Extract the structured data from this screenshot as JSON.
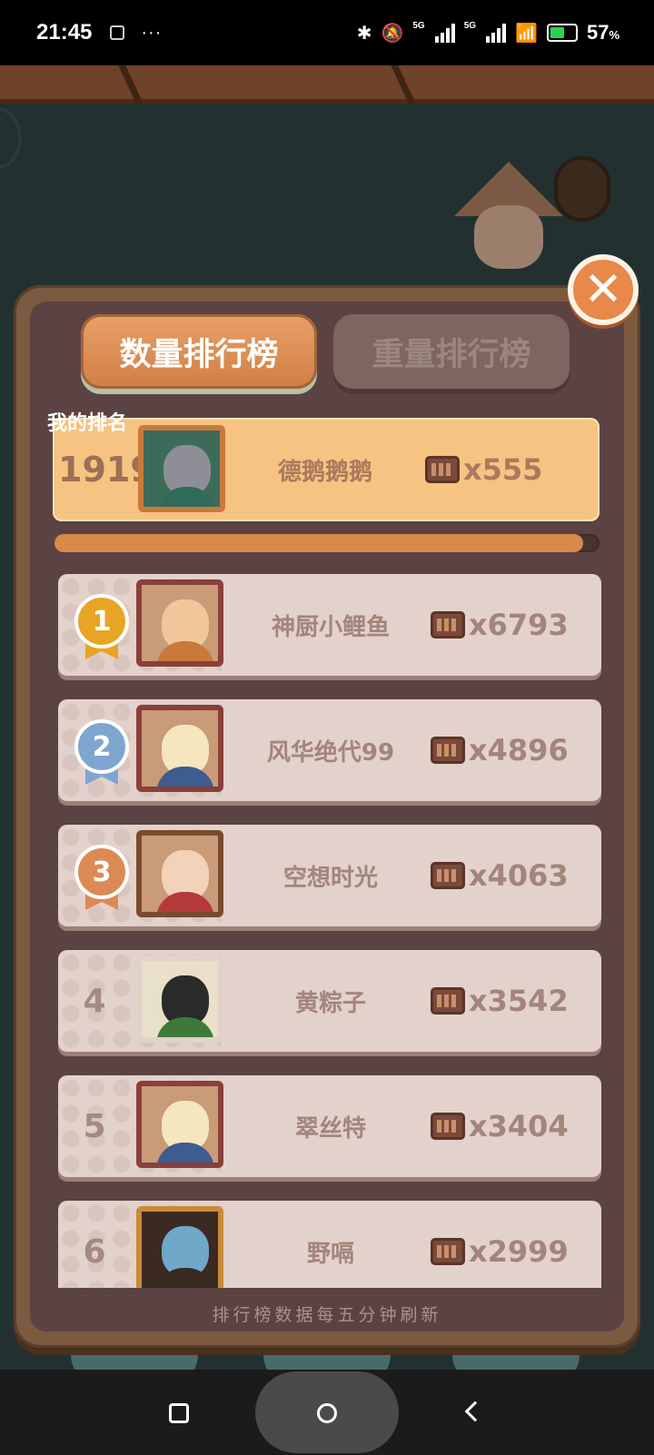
{
  "status_bar": {
    "time": "21:45",
    "dots": "···",
    "network_label": "5G",
    "battery_percent": 57,
    "battery_label": "57",
    "battery_unit": "%"
  },
  "tabs": {
    "count_ranking": "数量排行榜",
    "weight_ranking": "重量排行榜",
    "active": "count_ranking"
  },
  "my_rank": {
    "label": "我的排名",
    "rank": "1919",
    "name": "德鹅鹅鹅",
    "score": "x555"
  },
  "progress_fill": 0.97,
  "leaderboard": [
    {
      "rank": "1",
      "medal": "gold",
      "name": "神厨小鲤鱼",
      "score": "x6793"
    },
    {
      "rank": "2",
      "medal": "silver",
      "name": "风华绝代99",
      "score": "x4896"
    },
    {
      "rank": "3",
      "medal": "bronze",
      "name": "空想时光",
      "score": "x4063"
    },
    {
      "rank": "4",
      "name": "黄粽子",
      "score": "x3542"
    },
    {
      "rank": "5",
      "name": "翠丝特",
      "score": "x3404"
    },
    {
      "rank": "6",
      "name": "野嗝",
      "score": "x2999"
    }
  ],
  "footer_note": "排行榜数据每五分钟刷新",
  "colors": {
    "accent": "#d88a4a",
    "panel": "#5c4343",
    "row": "#e2d2cb",
    "my_row": "#f6c382",
    "gold": "#e8a424",
    "silver": "#7fa6cf",
    "bronze": "#dc8a55"
  }
}
